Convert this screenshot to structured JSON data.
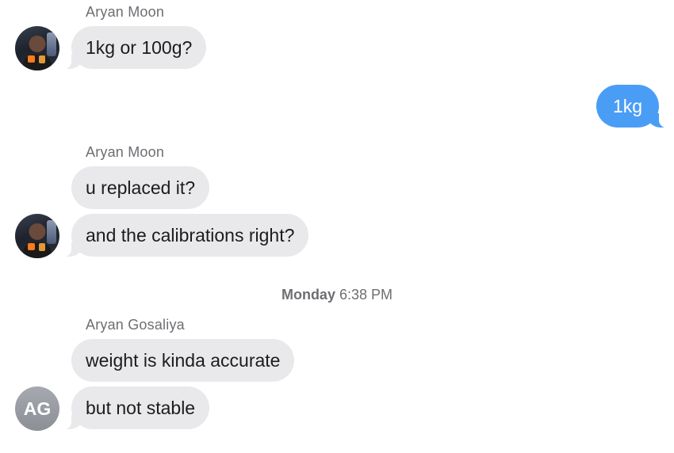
{
  "messages": [
    {
      "sender": "Aryan Moon",
      "text": "1kg or 100g?"
    },
    {
      "text": "1kg"
    },
    {
      "sender": "Aryan Moon",
      "text": "u replaced it?"
    },
    {
      "text": "and the calibrations right?"
    },
    {
      "sender": "Aryan Gosaliya",
      "text": "weight is kinda accurate"
    },
    {
      "text": "but not stable"
    }
  ],
  "timestamp": {
    "day": "Monday",
    "time": "6:38 PM"
  },
  "avatars": {
    "aryan_moon": {
      "icon": "profile-photo"
    },
    "aryan_gosaliya": {
      "initials": "AG"
    }
  },
  "colors": {
    "incoming_bubble": "#e9e9eb",
    "outgoing_bubble": "#4a9df5",
    "meta_text": "#6e6e73"
  }
}
